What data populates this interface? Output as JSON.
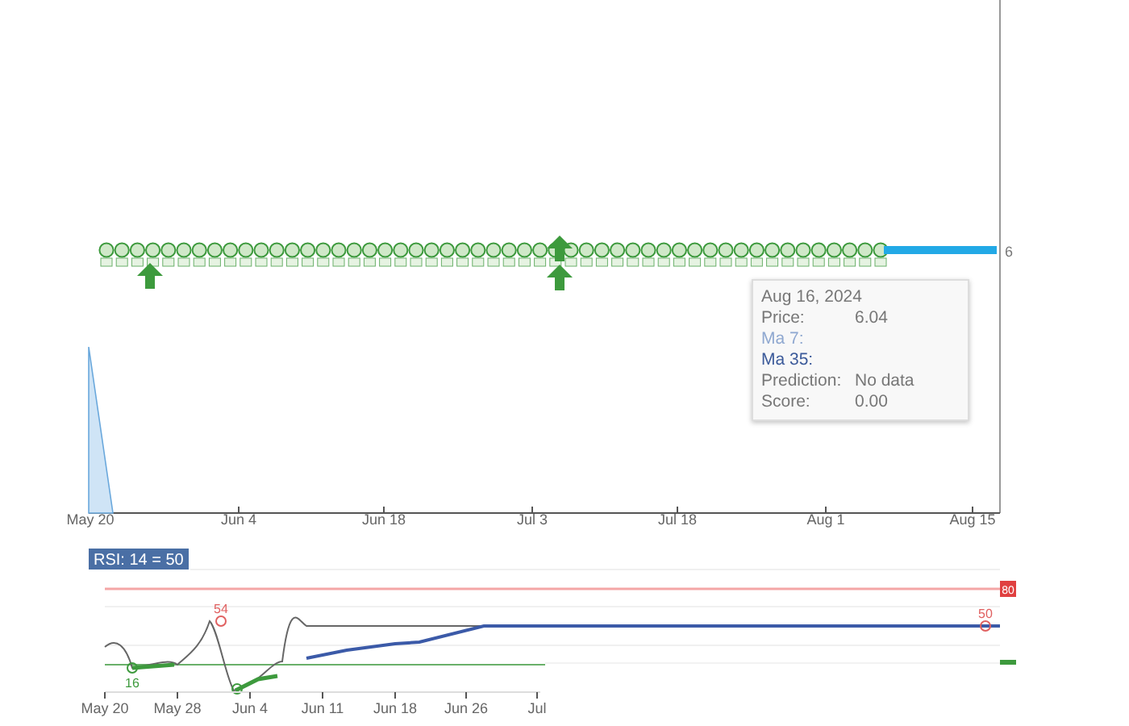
{
  "main_chart": {
    "x_labels": [
      "May 20",
      "Jun 4",
      "Jun 18",
      "Jul 3",
      "Jul 18",
      "Aug 1",
      "Aug 15"
    ],
    "last_value": "6"
  },
  "tooltip": {
    "date": "Aug 16, 2024",
    "rows": [
      {
        "kind": "plain",
        "label": "Price:",
        "value": "6.04"
      },
      {
        "kind": "ma7",
        "label": "Ma 7:"
      },
      {
        "kind": "ma35",
        "label": "Ma 35:"
      },
      {
        "kind": "plain",
        "label": "Prediction:",
        "value": "No data"
      },
      {
        "kind": "plain",
        "label": "Score:",
        "value": "0.00"
      }
    ]
  },
  "rsi": {
    "title": "RSI: 14 = 50",
    "upper_label": "80",
    "peak_label": "54",
    "low_label": "16",
    "last_label": "50",
    "x_labels": [
      "May 20",
      "May 28",
      "Jun 4",
      "Jun 11",
      "Jun 18",
      "Jun 26",
      "Jul"
    ]
  }
}
